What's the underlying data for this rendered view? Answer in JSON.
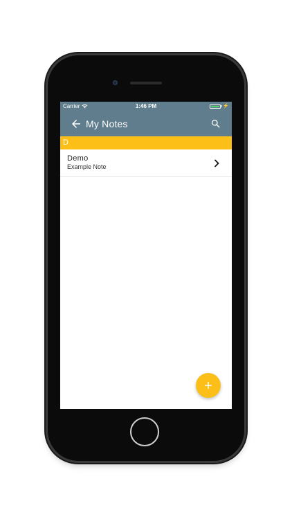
{
  "status_bar": {
    "carrier": "Carrier",
    "time": "1:46 PM",
    "battery_icon": "battery-charging-icon",
    "wifi_icon": "wifi-icon"
  },
  "app_bar": {
    "title": "My Notes",
    "back_icon": "arrow-left-icon",
    "search_icon": "search-icon",
    "background_color": "#5f7d8c"
  },
  "section": {
    "letter": "D",
    "color": "#fbbf18"
  },
  "notes": [
    {
      "title": "Demo",
      "subtitle": "Example Note"
    }
  ],
  "fab": {
    "icon": "plus-icon",
    "color": "#fbbf18"
  }
}
